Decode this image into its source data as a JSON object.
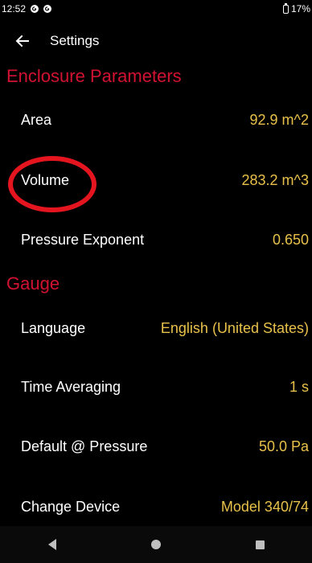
{
  "status_bar": {
    "time": "12:52",
    "battery": "17%"
  },
  "app_bar": {
    "title": "Settings"
  },
  "sections": {
    "enclosure": {
      "header": "Enclosure Parameters",
      "rows": [
        {
          "label": "Area",
          "value": "92.9 m^2"
        },
        {
          "label": "Volume",
          "value": "283.2 m^3"
        },
        {
          "label": "Pressure Exponent",
          "value": "0.650"
        }
      ]
    },
    "gauge": {
      "header": "Gauge",
      "rows": [
        {
          "label": "Language",
          "value": "English (United States)"
        },
        {
          "label": "Time Averaging",
          "value": "1 s"
        },
        {
          "label": "Default @ Pressure",
          "value": "50.0 Pa"
        },
        {
          "label": "Change Device",
          "value": "Model 340/74"
        }
      ]
    }
  },
  "colors": {
    "section_header": "#d21232",
    "value_text": "#e8c14a",
    "annotation_ring": "#e51520"
  },
  "icons": {
    "back": "arrow-left-icon",
    "nav_back": "triangle-back-icon",
    "nav_home": "circle-home-icon",
    "nav_recent": "square-recent-icon"
  }
}
